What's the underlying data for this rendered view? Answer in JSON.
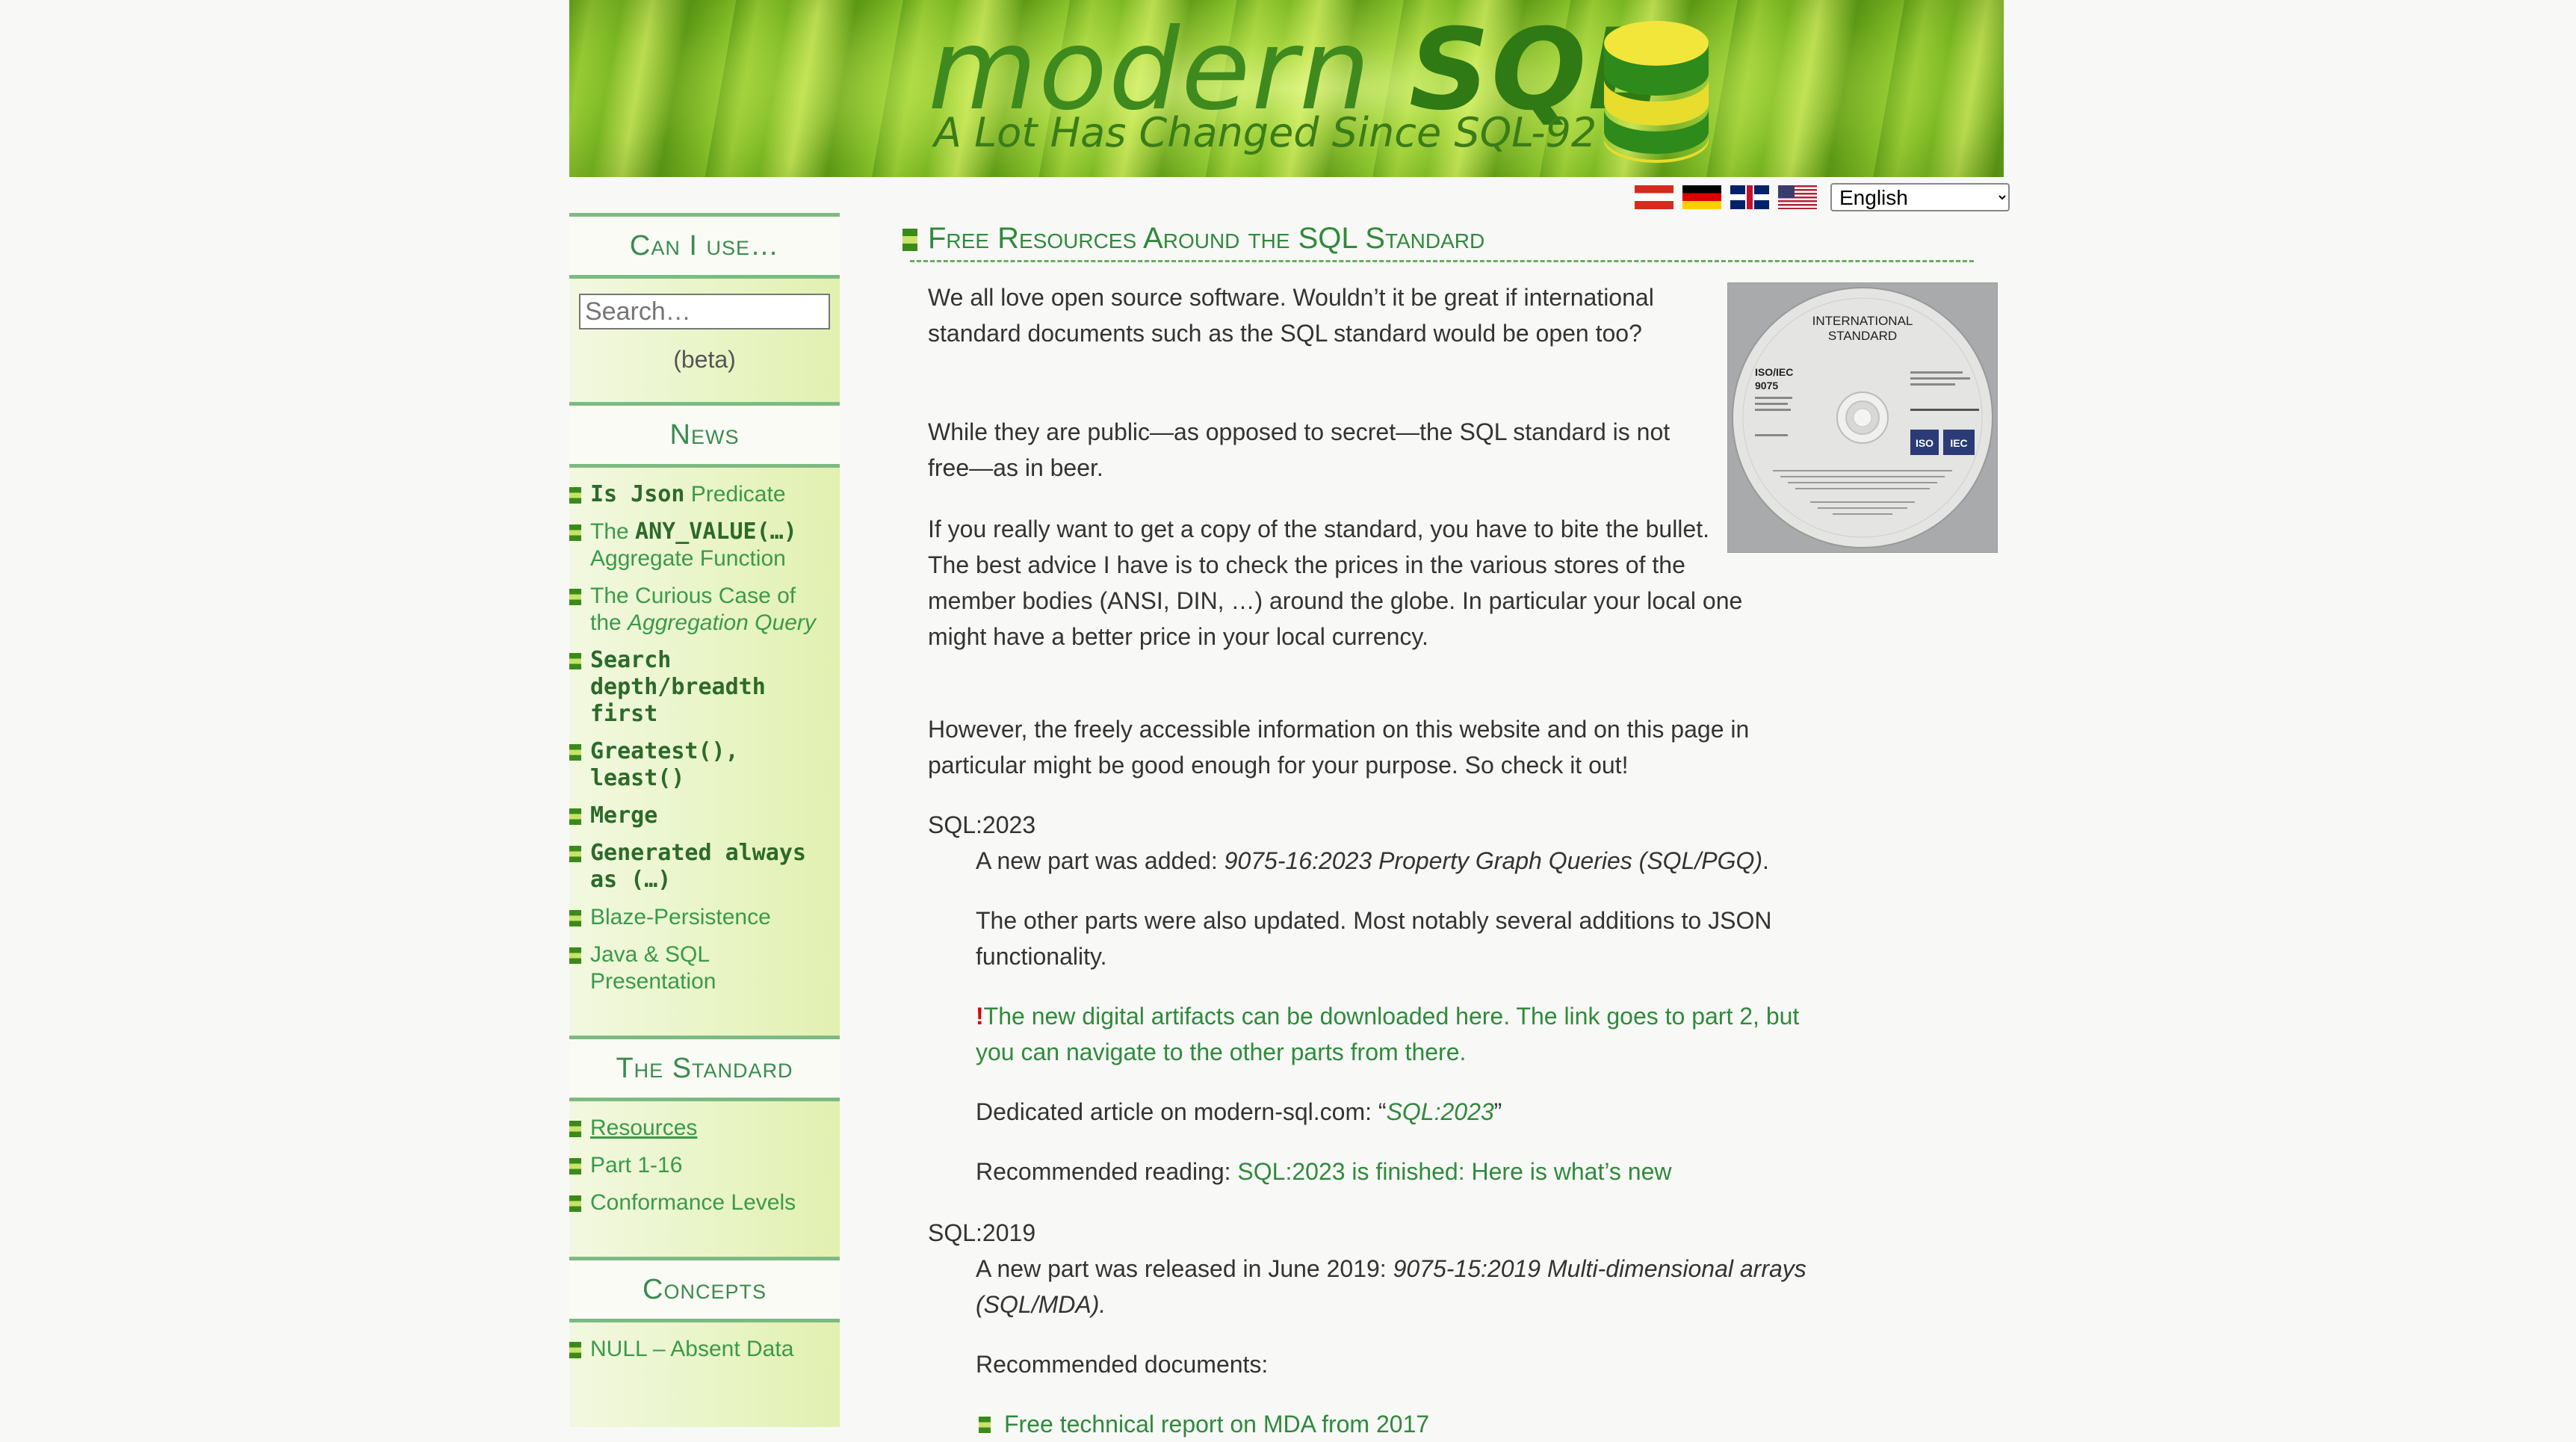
{
  "banner": {
    "logo_word1": "modern",
    "logo_word2": "SQL",
    "tagline": "A Lot Has Changed Since SQL-92"
  },
  "language": {
    "flags": [
      "flag-at",
      "flag-de",
      "flag-gb",
      "flag-us"
    ],
    "selected": "English"
  },
  "sidebar": {
    "can_i_use": {
      "heading": "Can I use…",
      "search_placeholder": "Search…",
      "beta": "(beta)"
    },
    "news": {
      "heading": "News",
      "items": {
        "is_json_code": "Is Json",
        "is_json_text": " Predicate",
        "any_value_pre": "The ",
        "any_value_code": "ANY_VALUE(…)",
        "any_value_text": " Aggregate Function",
        "curious_pre": "The Curious Case of the ",
        "curious_it": "Aggregation Query",
        "search_code": "Search depth/breadth first",
        "greatest_code": "Greatest(), least()",
        "merge_code": "Merge",
        "generated_code": "Generated always as (…)",
        "blaze": "Blaze-Persistence",
        "java_sql": "Java & SQL Presentation"
      }
    },
    "standard": {
      "heading": "The Standard",
      "items": [
        "Resources",
        "Part 1-16",
        "Conformance Levels"
      ]
    },
    "concepts": {
      "heading": "Concepts",
      "items": [
        "NULL – Absent Data"
      ]
    }
  },
  "article": {
    "title": "Free Resources Around the SQL Standard",
    "intro1": "We all love open source software. Wouldn’t it be great if international standard documents such as the SQL standard would be open too?",
    "intro2": "While they are public—as opposed to secret—the SQL standard is not free—as in beer.",
    "intro3": "If you really want to get a copy of the standard, you have to bite the bullet. The best advice I have is to check the prices in the various stores of the member bodies (ANSI, DIN, …) around the globe. In particular your local one might have a better price in your local currency.",
    "intro4": "However, the freely accessible information on this website and on this page in particular might be good enough for your purpose. So check it out!",
    "cd": {
      "line1": "INTERNATIONAL",
      "line2": "STANDARD",
      "iso_iec": "ISO/IEC",
      "number": "9075",
      "badge1": "ISO",
      "badge2": "IEC"
    },
    "sql2023": {
      "heading": "SQL:2023",
      "p1_pre": "A new part was added: ",
      "p1_it": "9075-16:2023 Property Graph Queries (SQL/PGQ)",
      "p1_post": ".",
      "p2": "The other parts were also updated. Most notably several additions to JSON functionality.",
      "excl": "!",
      "p3_link": "The new digital artifacts can be downloaded here. The link goes to part 2, but you can navigate to the other parts from there.",
      "p4_pre": "Dedicated article on modern-sql.com: “",
      "p4_link": "SQL:2023",
      "p4_post": "”",
      "p5_pre": "Recommended reading: ",
      "p5_link": "SQL:2023 is finished: Here is what’s new"
    },
    "sql2019": {
      "heading": "SQL:2019",
      "p1_pre": "A new part was released in June 2019: ",
      "p1_it": "9075-15:2019 Multi-dimensional arrays (SQL/MDA)",
      "p1_post": ".",
      "p2": "Recommended documents:",
      "list": [
        "Free technical report on MDA from 2017"
      ]
    }
  }
}
